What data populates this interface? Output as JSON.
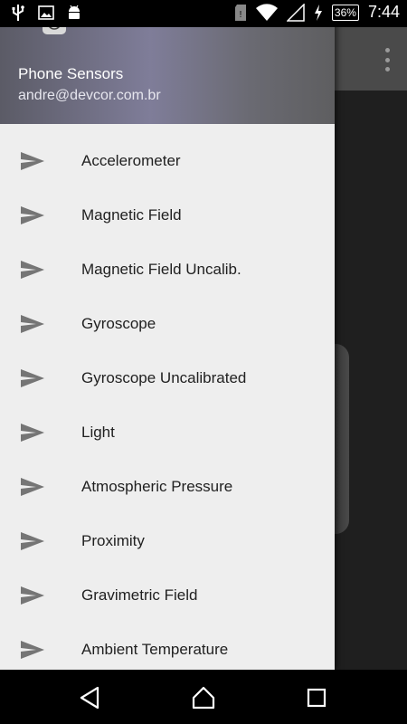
{
  "status_bar": {
    "time": "7:44",
    "battery": "36%",
    "left_icons": [
      "usb-icon",
      "image-icon",
      "android-icon"
    ],
    "right_icons": [
      "sd-card-icon",
      "wifi-icon",
      "signal-icon",
      "charging-icon"
    ]
  },
  "drawer": {
    "header": {
      "title": "Phone Sensors",
      "email": "andre@devcor.com.br"
    },
    "items": [
      {
        "label": "Accelerometer",
        "icon": "send-icon"
      },
      {
        "label": "Magnetic Field",
        "icon": "send-icon"
      },
      {
        "label": "Magnetic Field Uncalib.",
        "icon": "send-icon"
      },
      {
        "label": "Gyroscope",
        "icon": "send-icon"
      },
      {
        "label": "Gyroscope Uncalibrated",
        "icon": "send-icon"
      },
      {
        "label": "Light",
        "icon": "send-icon"
      },
      {
        "label": "Atmospheric Pressure",
        "icon": "send-icon"
      },
      {
        "label": "Proximity",
        "icon": "send-icon"
      },
      {
        "label": "Gravimetric Field",
        "icon": "send-icon"
      },
      {
        "label": "Ambient Temperature",
        "icon": "send-icon"
      }
    ]
  },
  "nav_bar": {
    "buttons": [
      "back-icon",
      "home-icon",
      "recents-icon"
    ]
  },
  "colors": {
    "drawer_bg": "#eeeeee",
    "text": "#212121",
    "icon": "#757575"
  }
}
